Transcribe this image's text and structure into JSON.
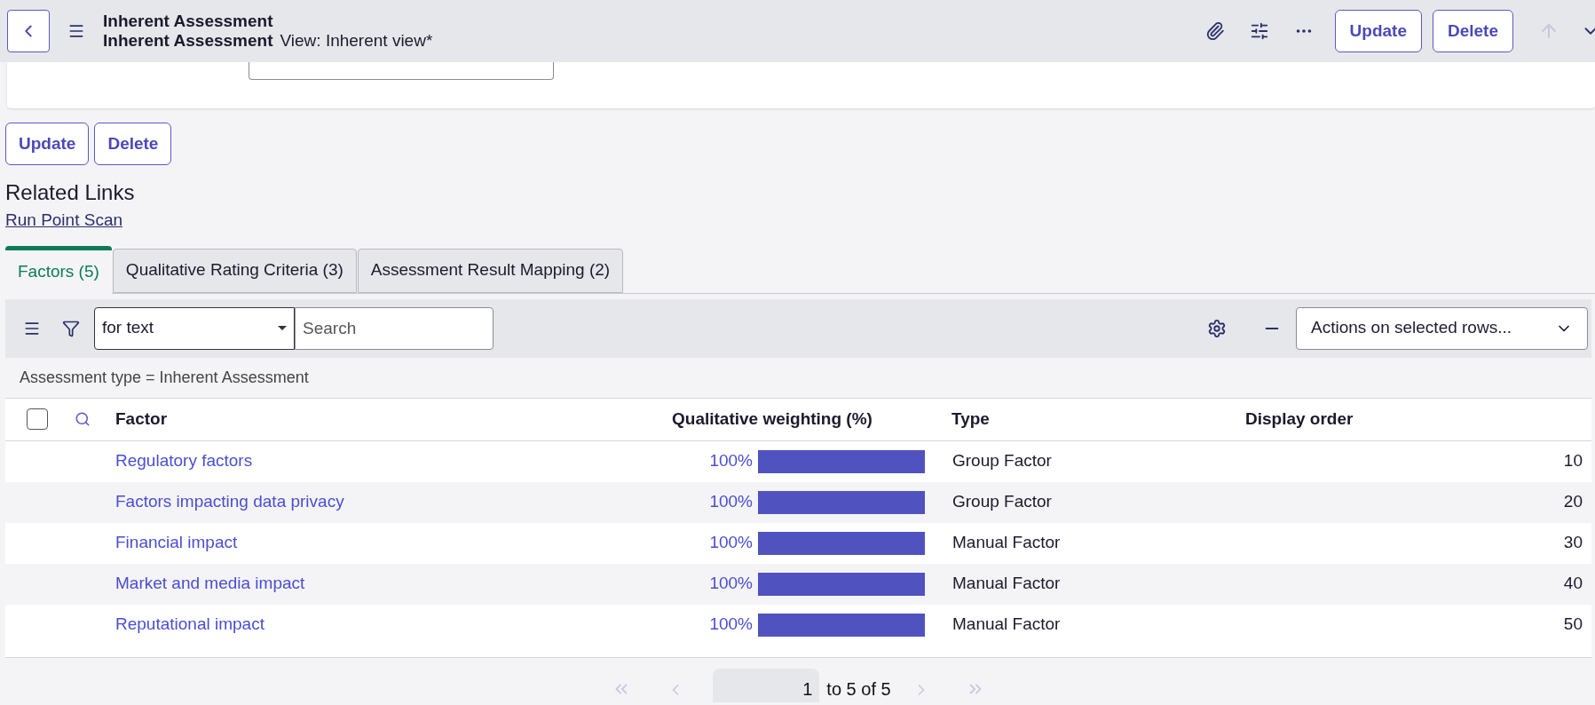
{
  "header": {
    "title": "Inherent Assessment",
    "subtitle": "Inherent Assessment",
    "view": "View: Inherent view*",
    "buttons": [
      "Update",
      "Delete"
    ]
  },
  "form_buttons": [
    "Update",
    "Delete"
  ],
  "related_links": {
    "title": "Related Links",
    "links": [
      "Run Point Scan"
    ]
  },
  "tabs": [
    {
      "label": "Factors (5)",
      "selected": true
    },
    {
      "label": "Qualitative Rating Criteria (3)",
      "selected": false
    },
    {
      "label": "Assessment Result Mapping (2)",
      "selected": false
    }
  ],
  "toolbar": {
    "search_type": "for text",
    "search_placeholder": "Search",
    "actions": "Actions on selected rows..."
  },
  "filter": "Assessment type = Inherent Assessment",
  "table": {
    "select_all_checked": false,
    "columns": [
      "Factor",
      "Qualitative weighting (%)",
      "Type",
      "Display order"
    ],
    "rows": [
      {
        "factor": "Regulatory factors",
        "weighting": "100%",
        "level": 1,
        "type": "Group Factor",
        "order": "10"
      },
      {
        "factor": "Factors impacting data privacy",
        "weighting": "100%",
        "level": 1,
        "type": "Group Factor",
        "order": "20"
      },
      {
        "factor": "Financial impact",
        "weighting": "100%",
        "level": 1,
        "type": "Manual Factor",
        "order": "30"
      },
      {
        "factor": "Market and media impact",
        "weighting": "100%",
        "level": 1,
        "type": "Manual Factor",
        "order": "40"
      },
      {
        "factor": "Reputational impact",
        "weighting": "100%",
        "level": 1,
        "type": "Manual Factor",
        "order": "50"
      }
    ]
  },
  "pagination": {
    "page": "1",
    "range": "to 5 of 5"
  }
}
